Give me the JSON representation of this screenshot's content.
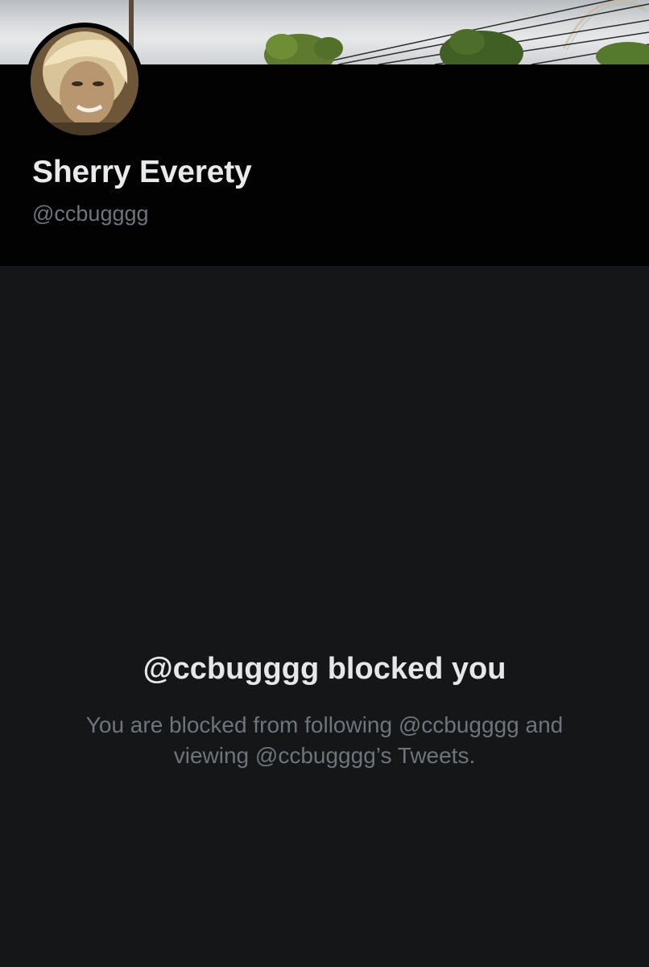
{
  "profile": {
    "display_name": "Sherry Everety",
    "handle": "@ccbugggg",
    "avatar_icon": "profile-photo",
    "banner_icon": "header-photo-sky-trees-power-lines"
  },
  "blocked_notice": {
    "title": "@ccbugggg blocked you",
    "description": "You are blocked from following @ccbugggg and viewing @ccbugggg’s Tweets."
  },
  "colors": {
    "header_background": "#020202",
    "page_background": "#151618",
    "primary_text": "#e9eaeb",
    "secondary_text": "#6d747b"
  }
}
